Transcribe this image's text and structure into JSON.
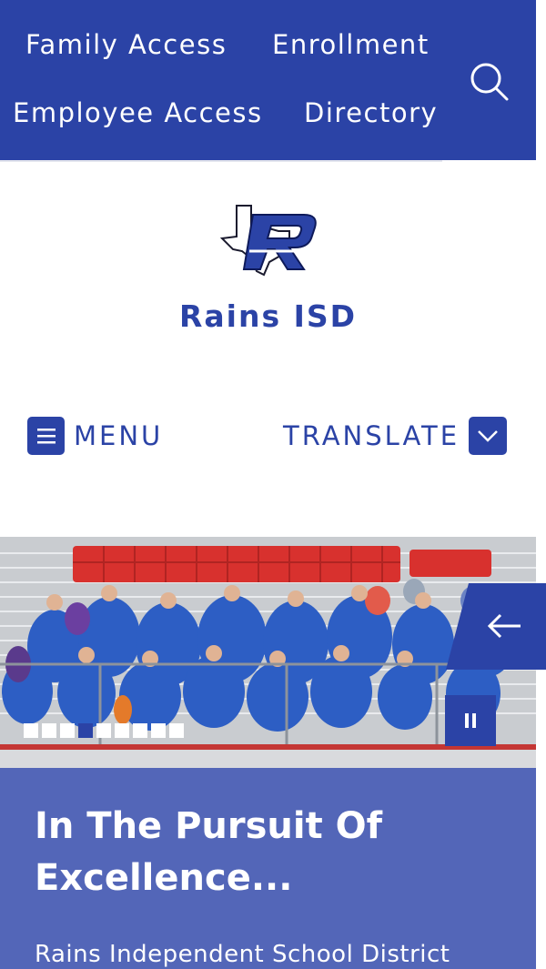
{
  "top_nav": {
    "family_access": "Family Access",
    "enrollment": "Enrollment",
    "employee_access": "Employee Access",
    "directory": "Directory",
    "search_icon": "search-icon"
  },
  "header": {
    "site_name": "Rains ISD",
    "logo_icon": "rains-r-texas-logo"
  },
  "nav": {
    "menu_label": "MENU",
    "menu_icon": "hamburger-icon",
    "translate_label": "TRANSLATE",
    "translate_icon": "chevron-down-icon"
  },
  "slideshow": {
    "image_alt": "Crowd of students in blue shirts seated in stadium bleachers",
    "dots": 10,
    "active_dot": 4,
    "prev_icon": "arrow-left-icon",
    "pause_icon": "pause-icon"
  },
  "caption": {
    "title": "In The Pursuit Of Excellence...",
    "text": "Rains Independent School District"
  },
  "colors": {
    "brand_blue": "#2b43a6",
    "caption_blue": "#5366b8",
    "stadium_red": "#d8312e"
  }
}
